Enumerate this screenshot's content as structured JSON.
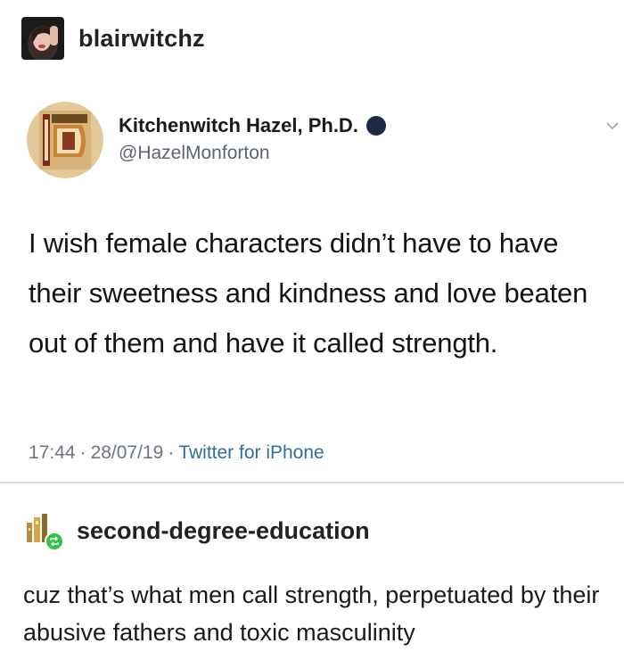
{
  "post": {
    "username": "blairwitchz"
  },
  "tweet": {
    "display_name": "Kitchenwitch Hazel, Ph.D.",
    "handle": "@HazelMonforton",
    "text": "I wish female characters didn’t have to have their sweetness and kindness and love beaten out of them and have it called strength.",
    "time": "17:44",
    "date": "28/07/19",
    "source": "Twitter for iPhone",
    "separator": "·"
  },
  "reblog": {
    "username": "second-degree-education",
    "text": "cuz that’s what men call strength, perpetuated by their abusive fathers and toxic masculinity"
  },
  "icons": {
    "verified": "verified-dot-icon",
    "caret": "chevron-down-icon",
    "reblog": "reblog-icon"
  },
  "colors": {
    "verified_dot": "#1e2a44",
    "source_link": "#2f6f9f",
    "reblog_badge": "#34c24b"
  }
}
